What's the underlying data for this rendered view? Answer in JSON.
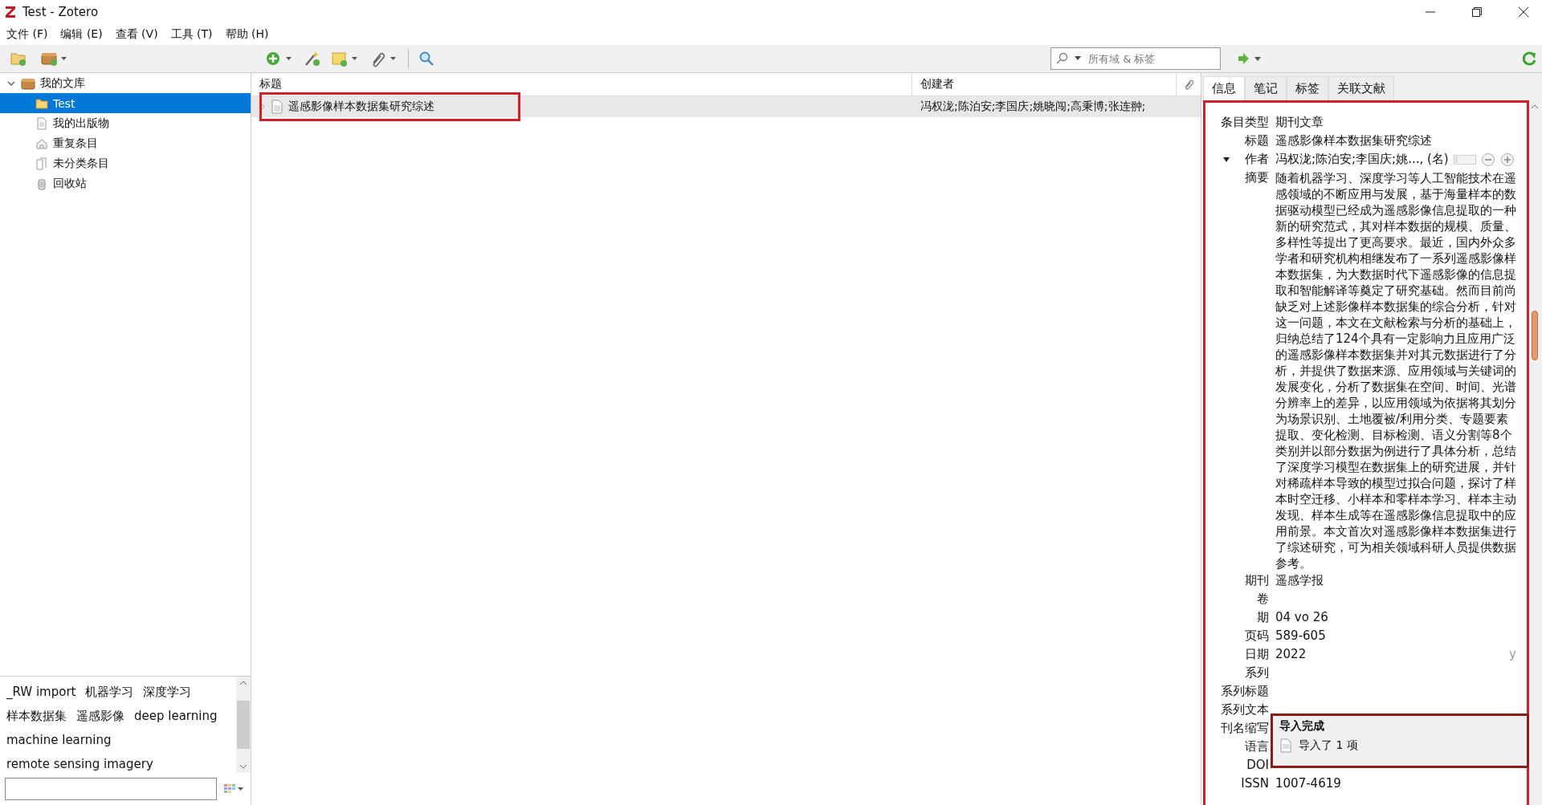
{
  "window": {
    "title": "Test - Zotero"
  },
  "menu": [
    "文件 (F)",
    "编辑 (E)",
    "查看 (V)",
    "工具 (T)",
    "帮助 (H)"
  ],
  "search": {
    "placeholder": "所有域 & 标签"
  },
  "library": {
    "label": "我的文库",
    "expanded": true,
    "children": [
      {
        "label": "Test",
        "selected": true,
        "kind": "folder"
      },
      {
        "label": "我的出版物",
        "selected": false,
        "kind": "publications"
      },
      {
        "label": "重复条目",
        "selected": false,
        "kind": "duplicates"
      },
      {
        "label": "未分类条目",
        "selected": false,
        "kind": "unfiled"
      },
      {
        "label": "回收站",
        "selected": false,
        "kind": "trash"
      }
    ]
  },
  "tags": [
    "_RW import",
    "机器学习",
    "深度学习",
    "样本数据集",
    "遥感影像",
    "deep learning",
    "machine learning",
    "remote sensing imagery"
  ],
  "items_table": {
    "columns": [
      "标题",
      "创建者"
    ],
    "rows": [
      {
        "title": "遥感影像样本数据集研究综述",
        "creator": "冯权泷;陈泊安;李国庆;姚晓闯;高秉博;张连翀;",
        "selected": true
      }
    ]
  },
  "item_pane": {
    "tabs": [
      {
        "label": "信息",
        "selected": true
      },
      {
        "label": "笔记",
        "selected": false
      },
      {
        "label": "标签",
        "selected": false
      },
      {
        "label": "关联文献",
        "selected": false
      }
    ],
    "fields": [
      {
        "label": "条目类型",
        "value": "期刊文章",
        "kind": "text"
      },
      {
        "label": "标题",
        "value": "遥感影像样本数据集研究综述",
        "kind": "text"
      },
      {
        "label": "作者",
        "value": "冯权泷;陈泊安;李国庆;姚..., (名)",
        "kind": "creator",
        "expanded": true
      },
      {
        "label": "摘要",
        "value": "随着机器学习、深度学习等人工智能技术在遥感领域的不断应用与发展，基于海量样本的数据驱动模型已经成为遥感影像信息提取的一种新的研究范式，其对样本数据的规模、质量、多样性等提出了更高要求。最近，国内外众多学者和研究机构相继发布了一系列遥感影像样本数据集，为大数据时代下遥感影像的信息提取和智能解译等奠定了研究基础。然而目前尚缺乏对上述影像样本数据集的综合分析，针对这一问题，本文在文献检索与分析的基础上，归纳总结了124个具有一定影响力且应用广泛的遥感影像样本数据集并对其元数据进行了分析，并提供了数据来源、应用领域与关键词的发展变化，分析了数据集在空间、时间、光谱分辨率上的差异，以应用领域为依据将其划分为场景识别、土地覆被/利用分类、专题要素提取、变化检测、目标检测、语义分割等8个类别并以部分数据为例进行了具体分析，总结了深度学习模型在数据集上的研究进展，并针对稀疏样本导致的模型过拟合问题，探讨了样本时空迁移、小样本和零样本学习、样本主动发现、样本生成等在遥感影像信息提取中的应用前景。本文首次对遥感影像样本数据集进行了综述研究，可为相关领域科研人员提供数据参考。",
        "kind": "abstract"
      },
      {
        "label": "期刊",
        "value": "遥感学报",
        "kind": "text"
      },
      {
        "label": "卷",
        "kind": "text"
      },
      {
        "label": "期",
        "value": "04 vo 26",
        "kind": "text"
      },
      {
        "label": "页码",
        "value": "589-605",
        "kind": "text"
      },
      {
        "label": "日期",
        "value": "2022",
        "note": "y",
        "kind": "text"
      },
      {
        "label": "系列",
        "kind": "text"
      },
      {
        "label": "系列标题",
        "kind": "text"
      },
      {
        "label": "系列文本",
        "kind": "text"
      },
      {
        "label": "刊名缩写",
        "kind": "text"
      },
      {
        "label": "语言",
        "kind": "text"
      },
      {
        "label": "DOI",
        "kind": "text"
      },
      {
        "label": "ISSN",
        "value": "1007-4619",
        "kind": "text"
      }
    ]
  },
  "notification": {
    "title": "导入完成",
    "message": "导入了 1 项"
  }
}
